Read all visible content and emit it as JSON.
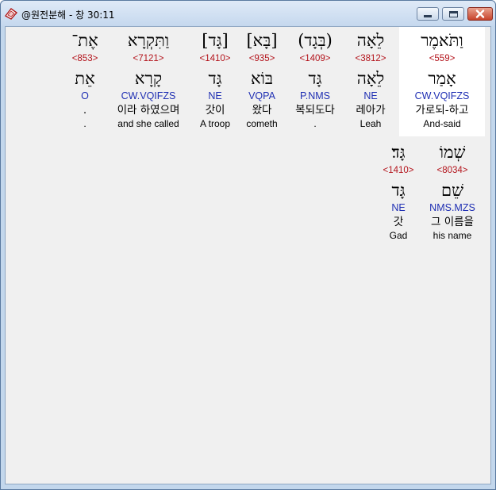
{
  "window": {
    "title": "@원전분해 - 창 30:11",
    "icon": "bible-book-icon",
    "close_color": "#c7432b"
  },
  "verse_rows": [
    {
      "words": [
        {
          "hebrew": "וַתֹּאמֶר",
          "strong": "<559>",
          "lemma": "אָמַר",
          "parsing": "CW.VQIFZS",
          "korean": "가로되-하고",
          "english": "And-said",
          "highlighted": true
        },
        {
          "hebrew": "לֵאָה",
          "strong": "<3812>",
          "lemma": "לֵאָה",
          "parsing": "NE",
          "korean": "레아가",
          "english": "Leah"
        },
        {
          "hebrew": "(בְּגָד)",
          "strong": "<1409>",
          "lemma": "גָּד",
          "parsing": "P.NMS",
          "korean": "복되도다",
          "english": "."
        },
        {
          "hebrew": "[בָּא]",
          "strong": "<935>",
          "lemma": "בּוֹא",
          "parsing": "VQPA",
          "korean": "왔다",
          "english": "cometh"
        },
        {
          "hebrew": "[גָּד]",
          "strong": "<1410>",
          "lemma": "גָּד",
          "parsing": "NE",
          "korean": "갓이",
          "english": "A troop"
        },
        {
          "hebrew": "וַתִּקְרָא",
          "strong": "<7121>",
          "lemma": "קָרָא",
          "parsing": "CW.VQIFZS",
          "korean": "이라 하였으며",
          "english": "and she called"
        },
        {
          "hebrew": "אֶת־",
          "strong": "<853>",
          "lemma": "אֵת",
          "parsing": "O",
          "korean": ".",
          "english": "."
        }
      ]
    },
    {
      "words": [
        {
          "hebrew": "שְׁמוֹ",
          "strong": "<8034>",
          "lemma": "שֵׁם",
          "parsing": "NMS.MZS",
          "korean": "그 이름을",
          "english": "his name"
        },
        {
          "hebrew": "גָּד׃",
          "strong": "<1410>",
          "lemma": "גָּד",
          "parsing": "NE",
          "korean": "갓",
          "english": "Gad"
        }
      ]
    }
  ],
  "colors": {
    "strong_number": "#b3131b",
    "parsing": "#1f2fb3",
    "highlight_bg": "#ffffff"
  }
}
